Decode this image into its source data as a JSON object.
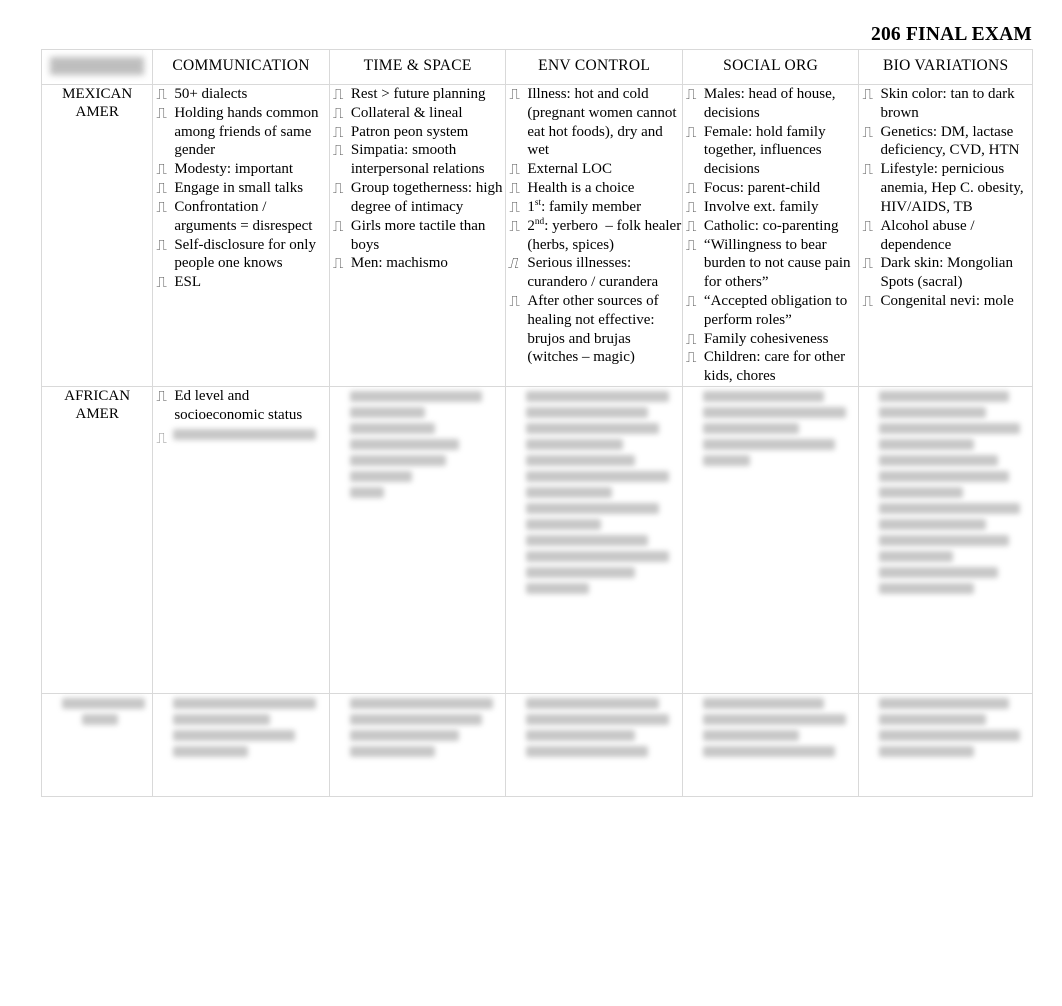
{
  "document": {
    "title": "206 FINAL EXAM"
  },
  "table": {
    "headers": [
      {
        "label": "",
        "redacted": true,
        "name": "header-blank-redacted"
      },
      {
        "label": "COMMUNICATION",
        "redacted": false,
        "name": "header-communication"
      },
      {
        "label": "TIME & SPACE",
        "redacted": false,
        "name": "header-time-space"
      },
      {
        "label": "ENV CONTROL",
        "redacted": false,
        "name": "header-env-control"
      },
      {
        "label": "SOCIAL ORG",
        "redacted": false,
        "name": "header-social-org"
      },
      {
        "label": "BIO VARIATIONS",
        "redacted": false,
        "name": "header-bio-variations"
      }
    ],
    "rows": [
      {
        "label": "MEXICAN AMER",
        "label_line1": "MEXICAN",
        "label_line2": "AMER",
        "redacted": false,
        "communication": [
          "50+ dialects",
          "Holding hands common among friends of same gender",
          "Modesty: important",
          "Engage in small talks",
          "Confrontation / arguments = disrespect",
          "Self-disclosure for only people one knows",
          "ESL"
        ],
        "time_space": [
          "Rest > future planning",
          "Collateral & lineal",
          "Patron peon system",
          "Simpatia: smooth interpersonal relations",
          "Group togetherness: high degree of intimacy",
          "Girls more tactile than boys",
          "Men: machismo"
        ],
        "env_control": [
          "Illness: hot and cold (pregnant women cannot eat hot foods), dry and wet",
          "External LOC",
          "Health is a choice",
          "1st: family member",
          "2nd: yerbero  – folk healer (herbs, spices)",
          "Serious illnesses: curandero / curandera",
          "After other sources of healing not effective: brujos and brujas (witches – magic)"
        ],
        "social_org": [
          "Males: head of house, decisions",
          "Female: hold family together, influences decisions",
          "Focus: parent-child",
          "Involve ext. family",
          "Catholic: co-parenting",
          "“Willingness to bear burden to not cause pain for others”",
          "“Accepted obligation to perform roles”",
          "Family cohesiveness",
          "Children: care for other kids, chores"
        ],
        "bio_variations": [
          "Skin color: tan to dark brown",
          "Genetics: DM, lactase deficiency, CVD, HTN",
          "Lifestyle: pernicious anemia, Hep C. obesity, HIV/AIDS, TB",
          "Alcohol abuse / dependence",
          "Dark skin: Mongolian Spots (sacral)",
          "Congenital nevi: mole"
        ]
      },
      {
        "label": "AFRICAN AMER",
        "label_line1": "AFRICAN",
        "label_line2": "AMER",
        "redacted": true,
        "communication": [
          "Ed level and socioeconomic status"
        ],
        "communication_illegible": true,
        "time_space": [],
        "env_control": [],
        "social_org": [],
        "bio_variations": []
      },
      {
        "label": "",
        "label_line1": "",
        "label_line2": "",
        "redacted": true,
        "communication": [],
        "time_space": [],
        "env_control": [],
        "social_org": [],
        "bio_variations": []
      }
    ]
  },
  "glyphs": {
    "bullet": "⎕",
    "bullet_slanted": "⎕"
  }
}
